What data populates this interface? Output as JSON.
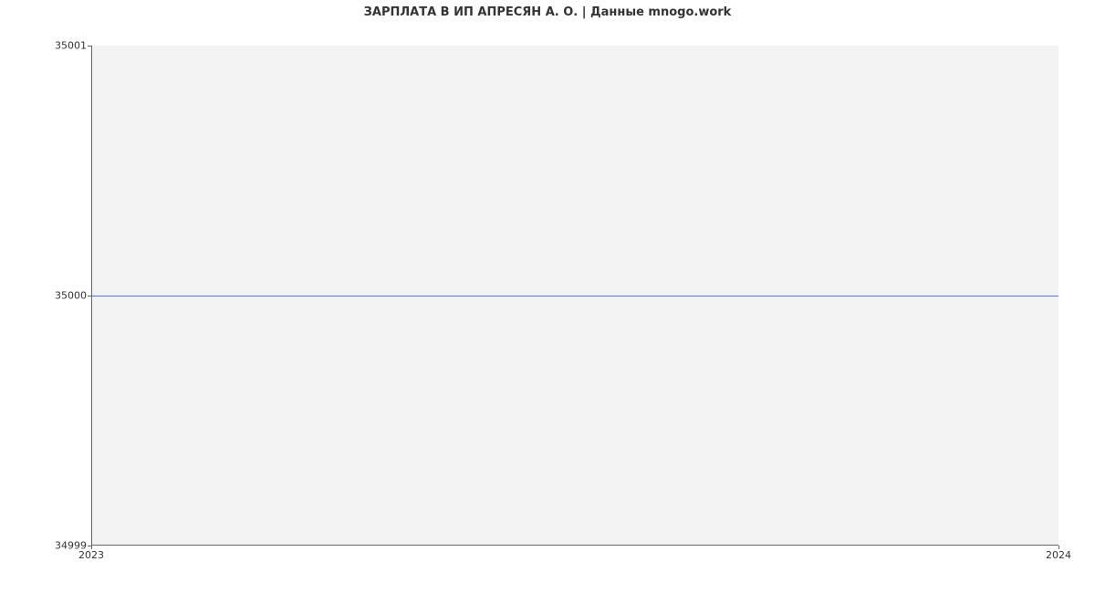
{
  "chart_data": {
    "type": "line",
    "title": "ЗАРПЛАТА В ИП АПРЕСЯН А. О. | Данные mnogo.work",
    "xlabel": "",
    "ylabel": "",
    "x": [
      "2023",
      "2024"
    ],
    "values": [
      35000,
      35000
    ],
    "y_ticks": [
      "34999",
      "35000",
      "35001"
    ],
    "ylim": [
      34999,
      35001
    ],
    "line_color": "#4a7bd0"
  }
}
